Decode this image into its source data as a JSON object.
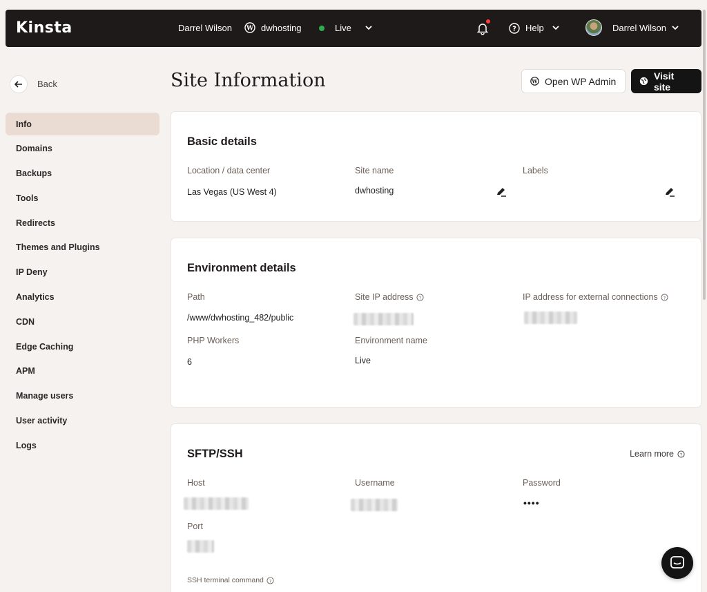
{
  "topbar": {
    "logo": "Kinsta",
    "user_name": "Darrel Wilson",
    "site_name": "dwhosting",
    "environment": "Live",
    "help_label": "Help",
    "account_name": "Darrel Wilson"
  },
  "sidebar": {
    "back_label": "Back",
    "items": [
      {
        "label": "Info"
      },
      {
        "label": "Domains"
      },
      {
        "label": "Backups"
      },
      {
        "label": "Tools"
      },
      {
        "label": "Redirects"
      },
      {
        "label": "Themes and Plugins"
      },
      {
        "label": "IP Deny"
      },
      {
        "label": "Analytics"
      },
      {
        "label": "CDN"
      },
      {
        "label": "Edge Caching"
      },
      {
        "label": "APM"
      },
      {
        "label": "Manage users"
      },
      {
        "label": "User activity"
      },
      {
        "label": "Logs"
      }
    ]
  },
  "header": {
    "title": "Site Information",
    "open_wp_admin": "Open WP Admin",
    "visit_site": "Visit site"
  },
  "basic_details": {
    "title": "Basic details",
    "location_label": "Location / data center",
    "location_value": "Las Vegas (US West 4)",
    "site_name_label": "Site name",
    "site_name_value": "dwhosting",
    "labels_label": "Labels"
  },
  "environment_details": {
    "title": "Environment details",
    "path_label": "Path",
    "path_value": "/www/dwhosting_482/public",
    "site_ip_label": "Site IP address",
    "external_ip_label": "IP address for external connections",
    "php_workers_label": "PHP Workers",
    "php_workers_value": "6",
    "env_name_label": "Environment name",
    "env_name_value": "Live"
  },
  "sftp": {
    "title": "SFTP/SSH",
    "learn_more": "Learn more",
    "host_label": "Host",
    "username_label": "Username",
    "password_label": "Password",
    "password_value": "••••",
    "port_label": "Port",
    "ssh_command_label": "SSH terminal command"
  },
  "colors": {
    "topbar_bg": "#1d1a19",
    "page_bg": "#f6f2ef",
    "active_nav": "#eadbd3",
    "live_dot": "#2eaa4f"
  }
}
